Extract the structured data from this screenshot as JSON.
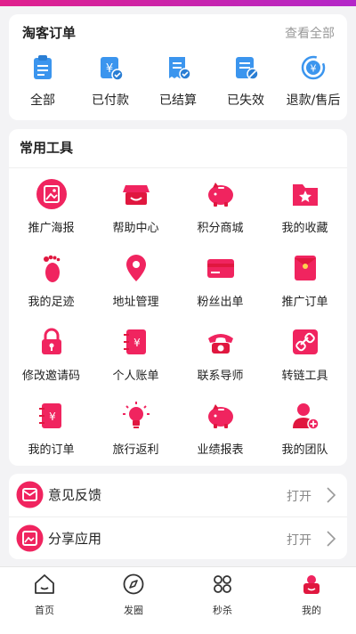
{
  "colors": {
    "accent": "#f0245f",
    "accent_dark": "#e0173f",
    "order_icon": "#2f8fe9",
    "top_gradient": [
      "#e0208c",
      "#b327c9"
    ]
  },
  "orders": {
    "title": "淘客订单",
    "view_all": "查看全部",
    "items": [
      {
        "label": "全部",
        "icon": "clipboard-icon"
      },
      {
        "label": "已付款",
        "icon": "yuan-paid-icon"
      },
      {
        "label": "已结算",
        "icon": "receipt-check-icon"
      },
      {
        "label": "已失效",
        "icon": "invalid-doc-icon"
      },
      {
        "label": "退款/售后",
        "icon": "refund-icon"
      }
    ]
  },
  "tools": {
    "title": "常用工具",
    "items": [
      {
        "label": "推广海报",
        "icon": "poster-icon"
      },
      {
        "label": "帮助中心",
        "icon": "store-icon"
      },
      {
        "label": "积分商城",
        "icon": "piggy-bank-icon"
      },
      {
        "label": "我的收藏",
        "icon": "star-folder-icon"
      },
      {
        "label": "我的足迹",
        "icon": "footprint-icon"
      },
      {
        "label": "地址管理",
        "icon": "location-pin-icon"
      },
      {
        "label": "粉丝出单",
        "icon": "card-icon"
      },
      {
        "label": "推广订单",
        "icon": "envelope-icon"
      },
      {
        "label": "修改邀请码",
        "icon": "lock-icon"
      },
      {
        "label": "个人账单",
        "icon": "notebook-yuan-icon"
      },
      {
        "label": "联系导师",
        "icon": "telephone-icon"
      },
      {
        "label": "转链工具",
        "icon": "link-icon"
      },
      {
        "label": "我的订单",
        "icon": "order-book-icon"
      },
      {
        "label": "旅行返利",
        "icon": "lightbulb-icon"
      },
      {
        "label": "业绩报表",
        "icon": "piggy-bank-icon"
      },
      {
        "label": "我的团队",
        "icon": "add-user-icon"
      }
    ]
  },
  "actions": [
    {
      "label": "意见反馈",
      "open": "打开",
      "icon": "feedback-icon"
    },
    {
      "label": "分享应用",
      "open": "打开",
      "icon": "share-image-icon"
    }
  ],
  "tabbar": [
    {
      "label": "首页",
      "icon": "home-icon"
    },
    {
      "label": "发圈",
      "icon": "compass-icon"
    },
    {
      "label": "秒杀",
      "icon": "command-icon"
    },
    {
      "label": "我的",
      "icon": "profile-icon",
      "active": true
    }
  ]
}
